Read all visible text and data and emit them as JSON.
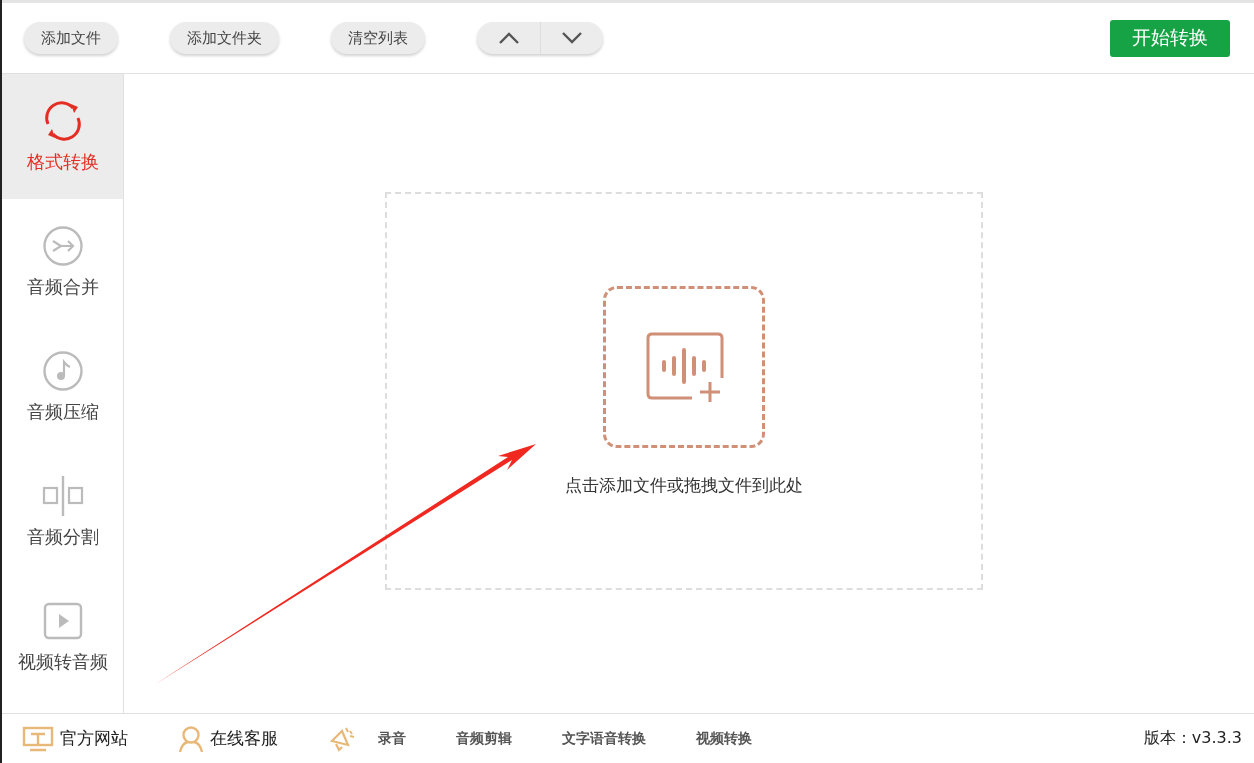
{
  "toolbar": {
    "buttons": [
      "添加文件",
      "添加文件夹",
      "清空列表"
    ],
    "start_button": "开始转换"
  },
  "sidebar": {
    "items": [
      {
        "label": "格式转换",
        "kind": "convert",
        "selected": true
      },
      {
        "label": "音频合并",
        "kind": "merge",
        "selected": false
      },
      {
        "label": "音频压缩",
        "kind": "compress",
        "selected": false
      },
      {
        "label": "音频分割",
        "kind": "split",
        "selected": false
      },
      {
        "label": "视频转音频",
        "kind": "video",
        "selected": false
      }
    ]
  },
  "dropzone": {
    "hint": "点击添加文件或拖拽文件到此处"
  },
  "status_bar": {
    "links": [
      {
        "label": "官方网站",
        "kind": "website"
      },
      {
        "label": "在线客服",
        "kind": "service"
      },
      {
        "label": "录音",
        "kind": "record"
      },
      {
        "label": "音频剪辑",
        "kind": "tool"
      },
      {
        "label": "文字语音转换",
        "kind": "tool"
      },
      {
        "label": "视频转换",
        "kind": "tool"
      }
    ],
    "version": "版本：v3.3.3"
  }
}
